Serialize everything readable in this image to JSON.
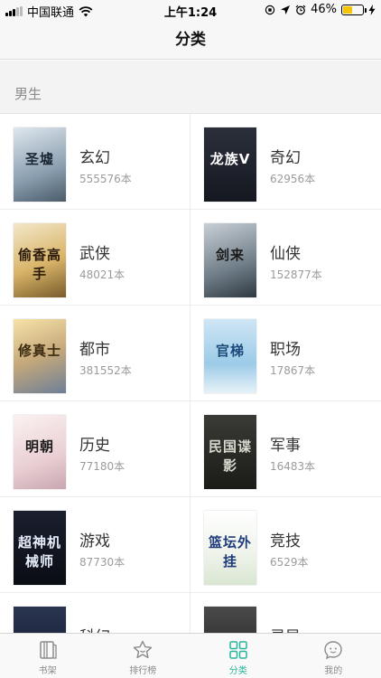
{
  "status_bar": {
    "carrier": "中国联通",
    "time": "上午1:24",
    "battery_percent": "46%",
    "battery_level": 0.46,
    "battery_color": "#f6c300"
  },
  "nav": {
    "title": "分类"
  },
  "section": {
    "title": "男生"
  },
  "colors": {
    "accent": "#28b69a",
    "inactive": "#8a8a8a"
  },
  "categories": [
    {
      "name": "玄幻",
      "count": "555576本",
      "cover_title": "圣墟",
      "cover_bg": "linear-gradient(160deg,#dfe7ee 0%,#8a9fb0 60%,#4b5b6a 100%)",
      "cover_fg": "#1a2633"
    },
    {
      "name": "奇幻",
      "count": "62956本",
      "cover_title": "龙族V",
      "cover_bg": "linear-gradient(180deg,#2b2f3a 0%,#151820 100%)",
      "cover_fg": "#ffffff"
    },
    {
      "name": "武侠",
      "count": "48021本",
      "cover_title": "偷香高手",
      "cover_bg": "linear-gradient(160deg,#f3e7c9 0%,#d9b56a 55%,#7a5b2a 100%)",
      "cover_fg": "#2a1a0a"
    },
    {
      "name": "仙侠",
      "count": "152877本",
      "cover_title": "剑来",
      "cover_bg": "linear-gradient(160deg,#c9d0d6 0%,#6f7d88 60%,#2f3840 100%)",
      "cover_fg": "#1a1a1a"
    },
    {
      "name": "都市",
      "count": "381552本",
      "cover_title": "修真士",
      "cover_bg": "linear-gradient(160deg,#f7e3a8 0%,#c6a97b 50%,#6e7f97 100%)",
      "cover_fg": "#3a2a10"
    },
    {
      "name": "职场",
      "count": "17867本",
      "cover_title": "官梯",
      "cover_bg": "linear-gradient(180deg,#cfe6f5 0%,#9ccbe8 60%,#e8f2f8 100%)",
      "cover_fg": "#1b4a7a"
    },
    {
      "name": "历史",
      "count": "77180本",
      "cover_title": "明朝",
      "cover_bg": "linear-gradient(160deg,#fbf2f2 0%,#e9cfd4 60%,#c9a6b0 100%)",
      "cover_fg": "#1a1a1a"
    },
    {
      "name": "军事",
      "count": "16483本",
      "cover_title": "民国谍影",
      "cover_bg": "linear-gradient(180deg,#3a3a36 0%,#1b1b18 100%)",
      "cover_fg": "#d9d9d0"
    },
    {
      "name": "游戏",
      "count": "87730本",
      "cover_title": "超神机械师",
      "cover_bg": "linear-gradient(180deg,#1a1f2e 0%,#0b0d14 100%)",
      "cover_fg": "#e6eefc"
    },
    {
      "name": "竞技",
      "count": "6529本",
      "cover_title": "篮坛外挂",
      "cover_bg": "linear-gradient(180deg,#ffffff 0%,#eef3ea 60%,#d9e6d2 100%)",
      "cover_fg": "#1f3a7a"
    },
    {
      "name": "科幻",
      "count": "",
      "cover_title": "",
      "cover_bg": "linear-gradient(180deg,#2a3550 0%,#11162a 100%)",
      "cover_fg": "#e0e6ff"
    },
    {
      "name": "灵异",
      "count": "",
      "cover_title": "",
      "cover_bg": "linear-gradient(180deg,#4a4a4a 0%,#1d1d1d 100%)",
      "cover_fg": "#e0e0e0"
    }
  ],
  "tabs": [
    {
      "label": "书架",
      "icon": "bookshelf-icon",
      "active": false
    },
    {
      "label": "排行榜",
      "icon": "star-icon",
      "active": false
    },
    {
      "label": "分类",
      "icon": "grid-icon",
      "active": true
    },
    {
      "label": "我的",
      "icon": "smiley-icon",
      "active": false
    }
  ]
}
